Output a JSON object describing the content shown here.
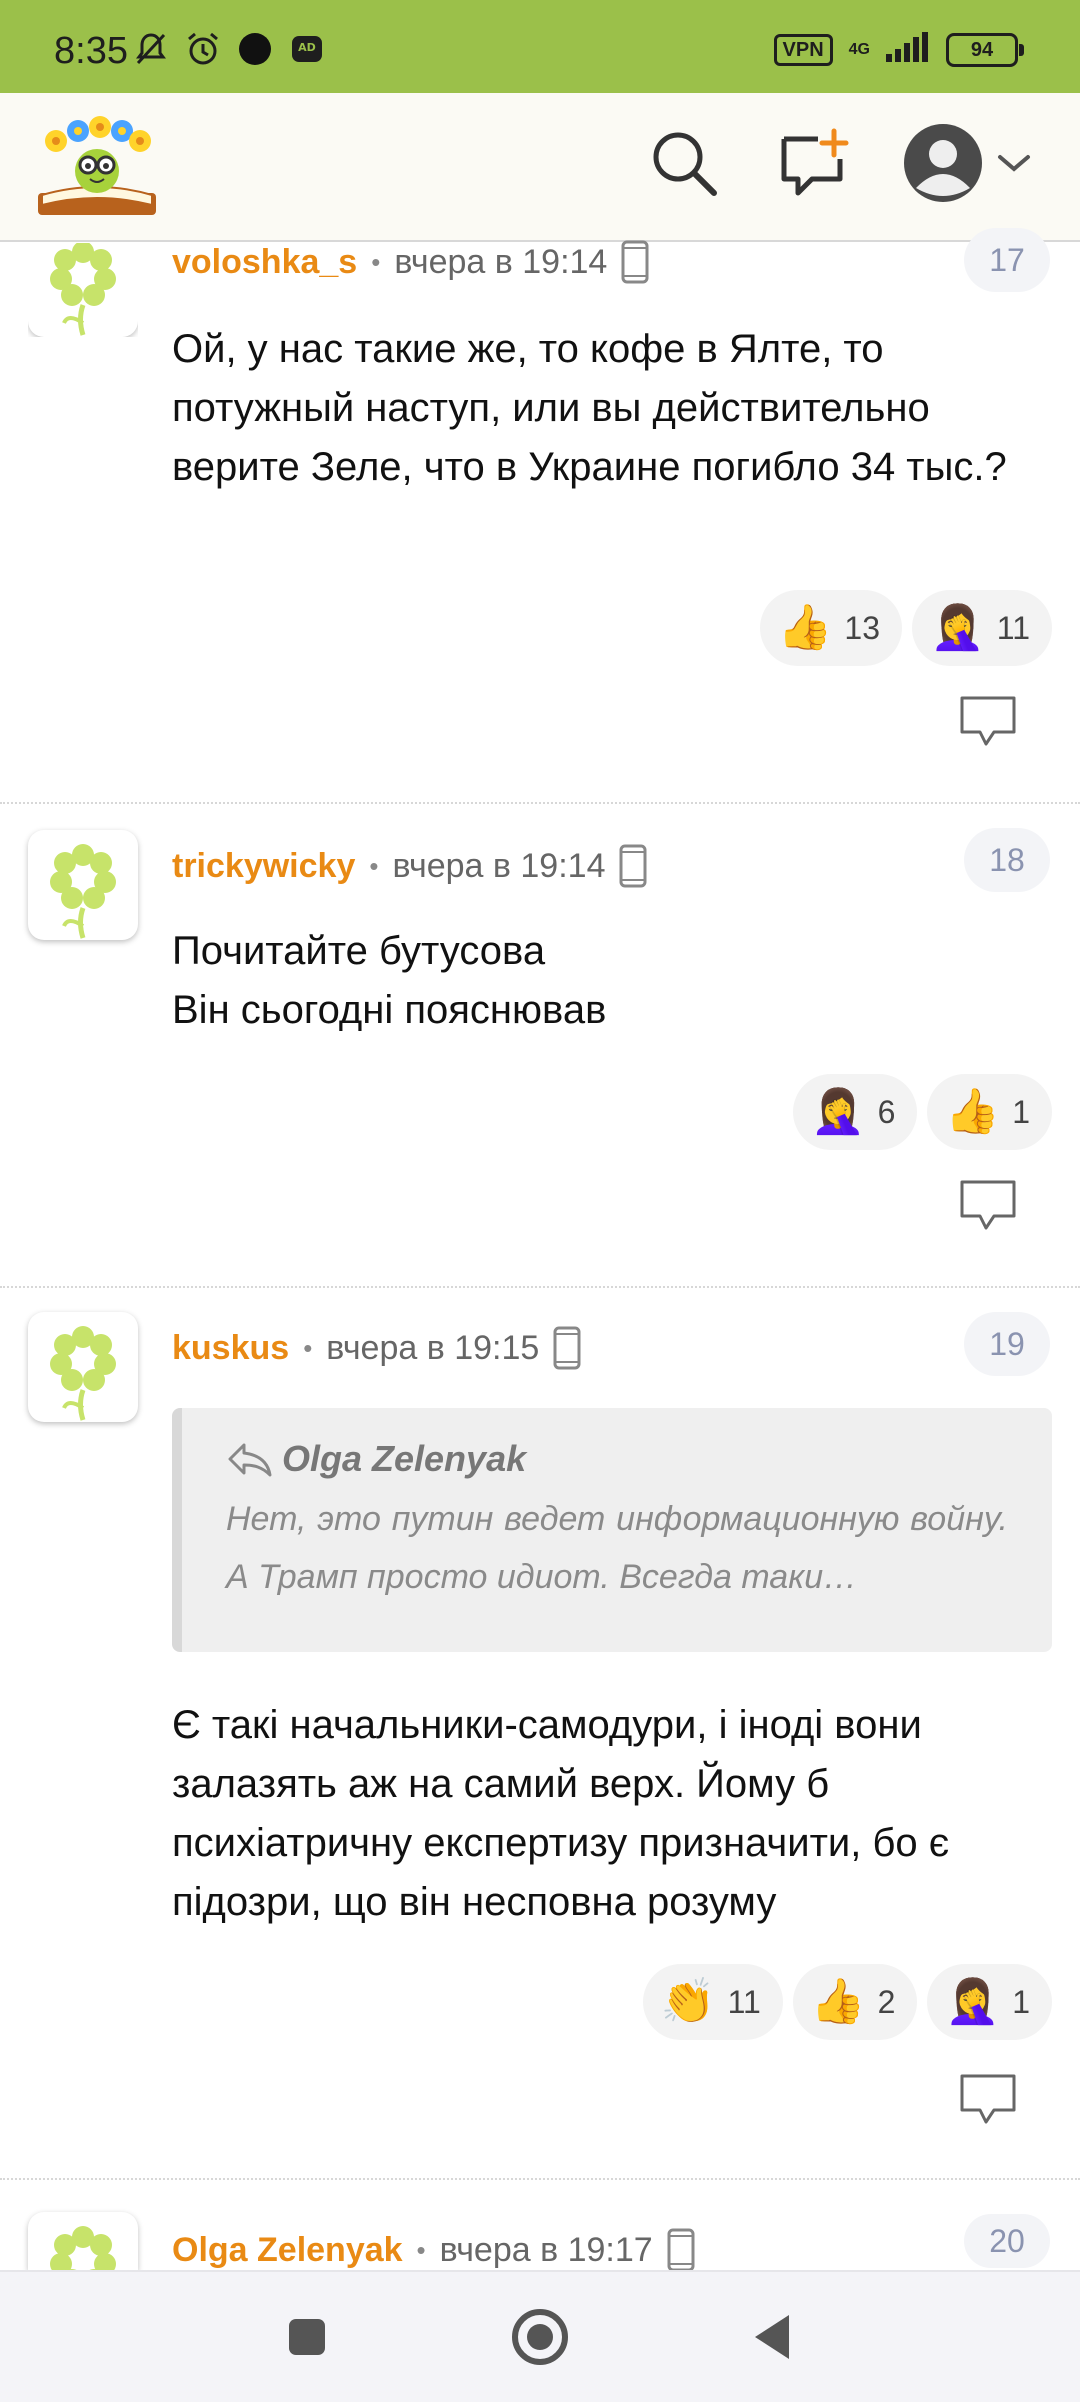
{
  "status_bar": {
    "time": "8:35",
    "vpn": "VPN",
    "network": "4G",
    "battery": "94"
  },
  "header": {
    "logo_icon": "kid-with-flowers-reading-book-logo",
    "search_icon": "search-icon",
    "new_post_icon": "add-comment-icon",
    "avatar_icon": "user-avatar-icon"
  },
  "comments": [
    {
      "author": "voloshka_s",
      "time": "вчера в 19:14",
      "number": "17",
      "text": "Ой, у нас такие же, то кофе в Ялте, то потужный наступ, или вы действительно верите Зеле, что в Украине погибло 34 тыс.?",
      "reactions": [
        {
          "emoji": "👍",
          "count": "13"
        },
        {
          "emoji": "🤦‍♀️",
          "count": "11"
        }
      ]
    },
    {
      "author": "trickywicky",
      "time": "вчера в 19:14",
      "number": "18",
      "text_line1": "Почитайте бутусова",
      "text_line2": "Він сьогодні пояснював",
      "reactions": [
        {
          "emoji": "🤦‍♀️",
          "count": "6"
        },
        {
          "emoji": "👍",
          "count": "1"
        }
      ]
    },
    {
      "author": "kuskus",
      "time": "вчера в 19:15",
      "number": "19",
      "quote_author": "Olga Zelenyak",
      "quote_text": "Нет, это путин ведет информационную войну. А Трамп просто идиот. Всегда таки…",
      "text": "Є такі начальники-самодури, і іноді вони залазять аж на самий верх. Йому б психіатричну експертизу призначити, бо є підозри, що він несповна розуму",
      "reactions": [
        {
          "emoji": "👏",
          "count": "11"
        },
        {
          "emoji": "👍",
          "count": "2"
        },
        {
          "emoji": "🤦‍♀️",
          "count": "1"
        }
      ]
    },
    {
      "author": "Olga Zelenyak",
      "time": "вчера в 19:17",
      "number": "20"
    }
  ],
  "colors": {
    "status_bar": "#9bc04a",
    "author": "#e98a14",
    "number_text": "#8a93b0"
  }
}
